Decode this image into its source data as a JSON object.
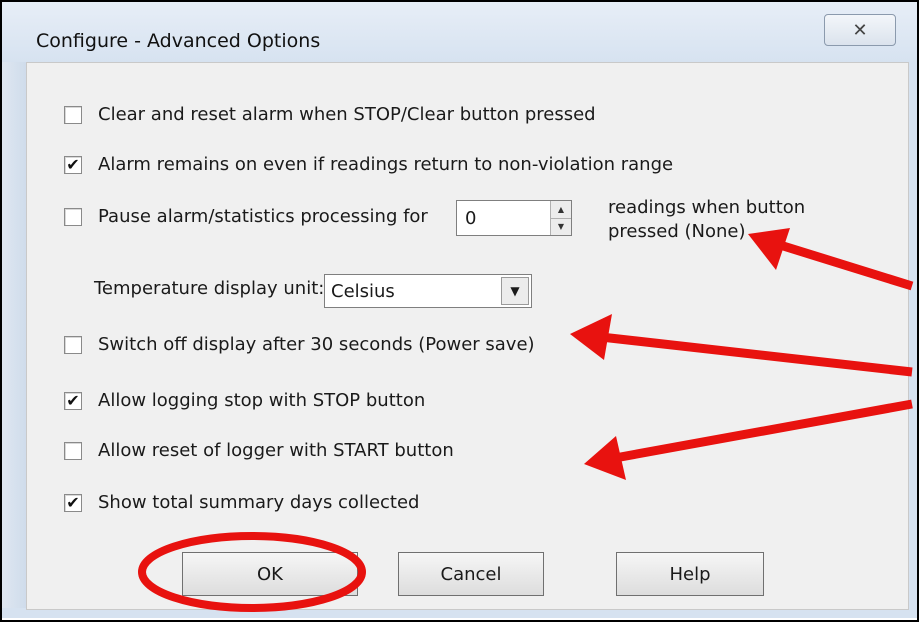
{
  "window": {
    "title": "Configure  - Advanced Options",
    "close_glyph": "✕"
  },
  "options": {
    "clear_reset": {
      "label": "Clear and reset alarm when STOP/Clear button pressed",
      "checked": false
    },
    "alarm_remains": {
      "label": "Alarm remains on even if readings return to non-violation range",
      "checked": true
    },
    "pause_alarm": {
      "label": "Pause alarm/statistics processing for",
      "checked": false
    },
    "pause_value": "0",
    "readings_line1": "readings when button",
    "readings_line2": "pressed (None)",
    "temp_unit_label": "Temperature display unit:",
    "temp_unit_value": "Celsius",
    "switch_off": {
      "label": "Switch off display after 30 seconds (Power save)",
      "checked": false
    },
    "allow_logging_stop": {
      "label": "Allow logging stop with STOP button",
      "checked": true
    },
    "allow_reset": {
      "label": "Allow reset of logger with START button",
      "checked": false
    },
    "show_summary": {
      "label": "Show total summary days collected",
      "checked": true
    }
  },
  "buttons": {
    "ok": "OK",
    "cancel": "Cancel",
    "help": "Help"
  },
  "glyphs": {
    "checked": "✔",
    "unchecked": "",
    "spin_up": "▲",
    "spin_down": "▼",
    "dropdown": "▼"
  },
  "annotation_color": "#e8120f"
}
